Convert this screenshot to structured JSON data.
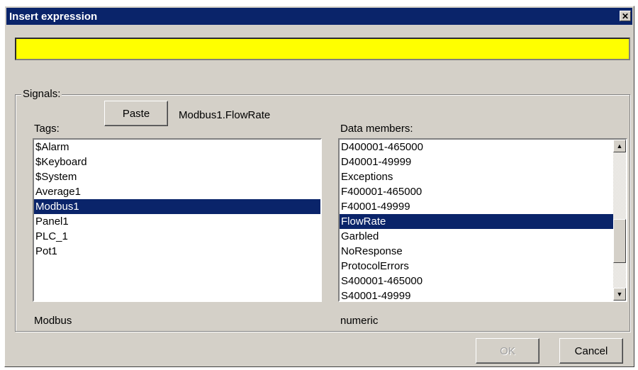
{
  "window": {
    "title": "Insert expression"
  },
  "expression": {
    "value": ""
  },
  "signals": {
    "group_label": "Signals:",
    "paste_label": "Paste",
    "selected_path": "Modbus1.FlowRate",
    "tags_label": "Tags:",
    "data_members_label": "Data members:",
    "tags": [
      "$Alarm",
      "$Keyboard",
      "$System",
      "Average1",
      "Modbus1",
      "Panel1",
      "PLC_1",
      "Pot1"
    ],
    "tags_selected": "Modbus1",
    "data_members": [
      "D400001-465000",
      "D40001-49999",
      "Exceptions",
      "F400001-465000",
      "F40001-49999",
      "FlowRate",
      "Garbled",
      "NoResponse",
      "ProtocolErrors",
      "S400001-465000",
      "S40001-49999"
    ],
    "data_members_selected": "FlowRate",
    "tag_type": "Modbus",
    "member_type": "numeric"
  },
  "buttons": {
    "ok_label": "OK",
    "cancel_label": "Cancel"
  },
  "icons": {
    "close": "close-icon",
    "scroll_up": "scroll-up-arrow-icon",
    "scroll_down": "scroll-down-arrow-icon"
  },
  "colors": {
    "titlebar": "#0a246a",
    "expression_bg": "#ffff00",
    "selection": "#0a246a",
    "dialog_bg": "#d4d0c8"
  }
}
